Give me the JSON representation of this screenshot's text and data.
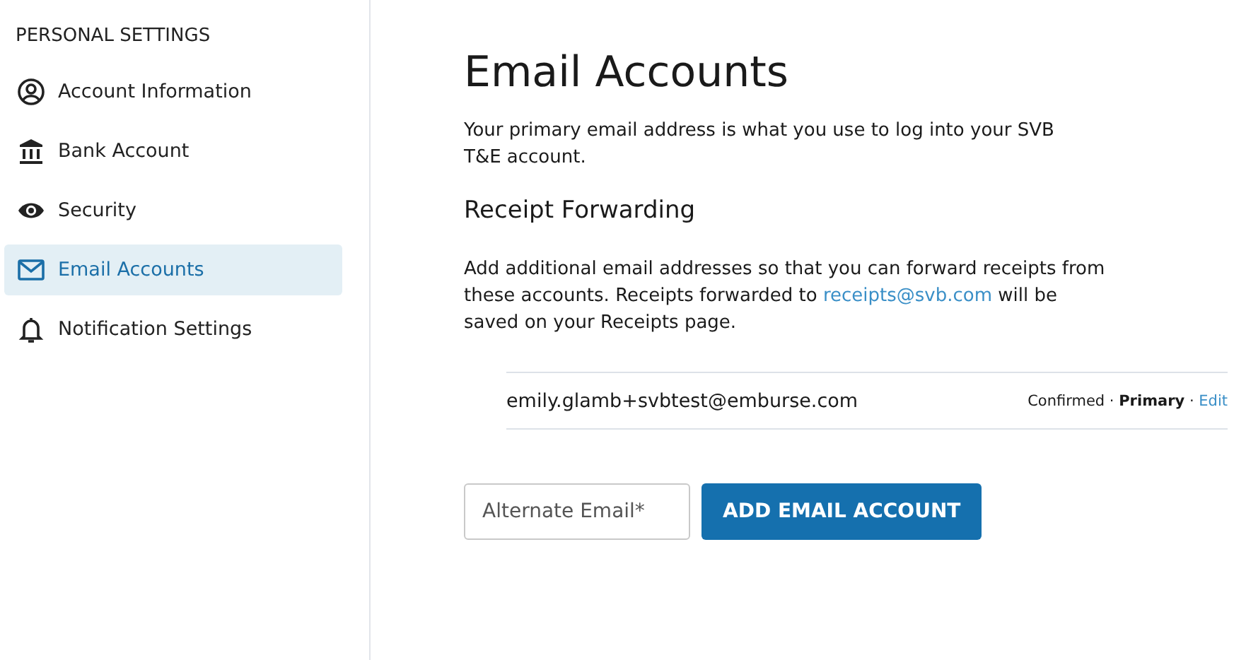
{
  "sidebar": {
    "heading": "PERSONAL SETTINGS",
    "items": [
      {
        "kind": "person",
        "label": "Account Information",
        "selected": false
      },
      {
        "kind": "bank",
        "label": "Bank Account",
        "selected": false
      },
      {
        "kind": "eye",
        "label": "Security",
        "selected": false
      },
      {
        "kind": "mail",
        "label": "Email Accounts",
        "selected": true
      },
      {
        "kind": "bell",
        "label": "Notification Settings",
        "selected": false
      }
    ]
  },
  "main": {
    "title": "Email Accounts",
    "intro": "Your primary email address is what you use to log into your SVB T&E account.",
    "section_title": "Receipt Forwarding",
    "description": {
      "before": "Add additional email addresses so that you can forward receipts from these accounts. Receipts forwarded to",
      "link": "receipts@svb.com",
      "after": "will be saved on your Receipts page."
    },
    "emails": [
      {
        "address": "emily.glamb+svbtest@emburse.com",
        "status": "Confirmed · **Primary** ·",
        "action": "Edit"
      }
    ],
    "input": {
      "placeholder": "Alternate Email*"
    },
    "button": "ADD EMAIL ACCOUNT"
  }
}
